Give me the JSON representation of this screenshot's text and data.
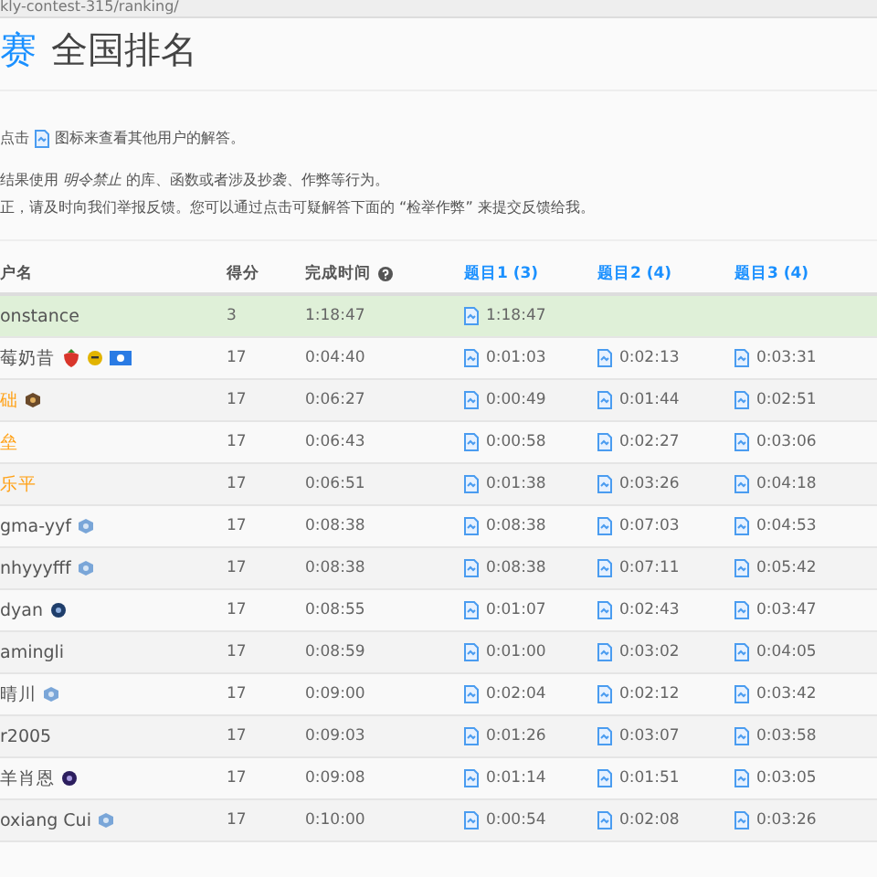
{
  "address_bar": {
    "url": "kly-contest-315/ranking/"
  },
  "title": {
    "link": "赛",
    "text": "全国排名"
  },
  "notes": [
    {
      "before": "点击",
      "after": "图标来查看其他用户的解答。"
    },
    {
      "text": "结果使用 *明令禁止* 的库、函数或者涉及抄袭、作弊等行为。"
    },
    {
      "text": "正，请及时向我们举报反馈。您可以通过点击可疑解答下面的 “检举作弊” 来提交反馈给我。"
    }
  ],
  "table": {
    "columns": [
      "户名",
      "得分",
      "完成时间"
    ],
    "questions": [
      "题目1 (3)",
      "题目2 (4)",
      "题目3 (4)"
    ],
    "rows": [
      {
        "name": "onstance",
        "color": "#555555",
        "self": true,
        "badges": [],
        "score": "3",
        "time": "1:18:47",
        "times": [
          "1:18:47"
        ]
      },
      {
        "name": "莓奶昔",
        "color": "#555555",
        "self": false,
        "badges": [
          {
            "kind": "strawberry"
          },
          {
            "kind": "smile"
          },
          {
            "kind": "flag"
          }
        ],
        "score": "17",
        "time": "0:04:40",
        "times": [
          "0:01:03",
          "0:02:13",
          "0:03:31"
        ]
      },
      {
        "name": "础",
        "color": "#ffa116",
        "self": false,
        "badges": [
          {
            "kind": "knight"
          }
        ],
        "score": "17",
        "time": "0:06:27",
        "times": [
          "0:00:49",
          "0:01:44",
          "0:02:51"
        ]
      },
      {
        "name": "垒",
        "color": "#ffa116",
        "self": false,
        "badges": [],
        "score": "17",
        "time": "0:06:43",
        "times": [
          "0:00:58",
          "0:02:27",
          "0:03:06"
        ]
      },
      {
        "name": "乐平",
        "color": "#ffa116",
        "self": false,
        "badges": [],
        "score": "17",
        "time": "0:06:51",
        "times": [
          "0:01:38",
          "0:03:26",
          "0:04:18"
        ]
      },
      {
        "name": "gma-yyf",
        "color": "#555555",
        "self": false,
        "badges": [
          {
            "kind": "guardian"
          }
        ],
        "score": "17",
        "time": "0:08:38",
        "times": [
          "0:08:38",
          "0:07:03",
          "0:04:53"
        ]
      },
      {
        "name": "nhyyyfff",
        "color": "#555555",
        "self": false,
        "badges": [
          {
            "kind": "guardian"
          }
        ],
        "score": "17",
        "time": "0:08:38",
        "times": [
          "0:08:38",
          "0:07:11",
          "0:05:42"
        ]
      },
      {
        "name": "dyan",
        "color": "#555555",
        "self": false,
        "badges": [
          {
            "kind": "dark"
          }
        ],
        "score": "17",
        "time": "0:08:55",
        "times": [
          "0:01:07",
          "0:02:43",
          "0:03:47"
        ]
      },
      {
        "name": "amingli",
        "color": "#555555",
        "self": false,
        "badges": [],
        "score": "17",
        "time": "0:08:59",
        "times": [
          "0:01:00",
          "0:03:02",
          "0:04:05"
        ]
      },
      {
        "name": "晴川",
        "color": "#555555",
        "self": false,
        "badges": [
          {
            "kind": "guardian"
          }
        ],
        "score": "17",
        "time": "0:09:00",
        "times": [
          "0:02:04",
          "0:02:12",
          "0:03:42"
        ]
      },
      {
        "name": "r2005",
        "color": "#555555",
        "self": false,
        "badges": [],
        "score": "17",
        "time": "0:09:03",
        "times": [
          "0:01:26",
          "0:03:07",
          "0:03:58"
        ]
      },
      {
        "name": "羊肖恩",
        "color": "#555555",
        "self": false,
        "badges": [
          {
            "kind": "purple"
          }
        ],
        "score": "17",
        "time": "0:09:08",
        "times": [
          "0:01:14",
          "0:01:51",
          "0:03:05"
        ]
      },
      {
        "name": "oxiang Cui",
        "color": "#555555",
        "self": false,
        "badges": [
          {
            "kind": "guardian"
          }
        ],
        "score": "17",
        "time": "0:10:00",
        "times": [
          "0:00:54",
          "0:02:08",
          "0:03:26"
        ]
      }
    ]
  }
}
